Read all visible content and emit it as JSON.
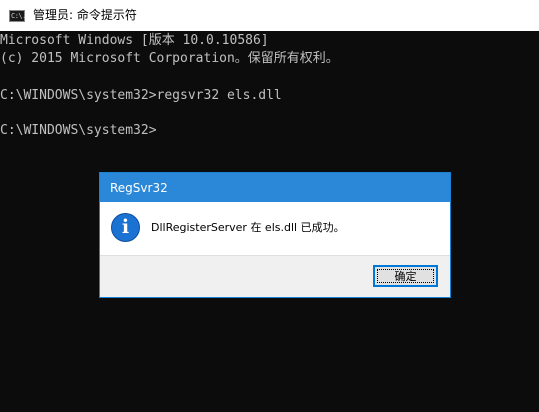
{
  "window": {
    "title": "管理员: 命令提示符",
    "icon": "cmd-icon",
    "icon_text": "C:\\."
  },
  "console": {
    "lines": [
      "Microsoft Windows [版本 10.0.10586]",
      "(c) 2015 Microsoft Corporation。保留所有权利。",
      "C:\\WINDOWS\\system32>regsvr32 els.dll",
      "C:\\WINDOWS\\system32>"
    ]
  },
  "dialog": {
    "title": "RegSvr32",
    "icon": "info-icon",
    "icon_glyph": "i",
    "message": "DllRegisterServer 在 els.dll 已成功。",
    "ok_label": "确定"
  },
  "colors": {
    "console_bg": "#0c0c0c",
    "console_text": "#c0c0c0",
    "dialog_title_bg": "#2b88d8",
    "info_icon": "#1b72d3",
    "button_focus": "#0078d7"
  }
}
